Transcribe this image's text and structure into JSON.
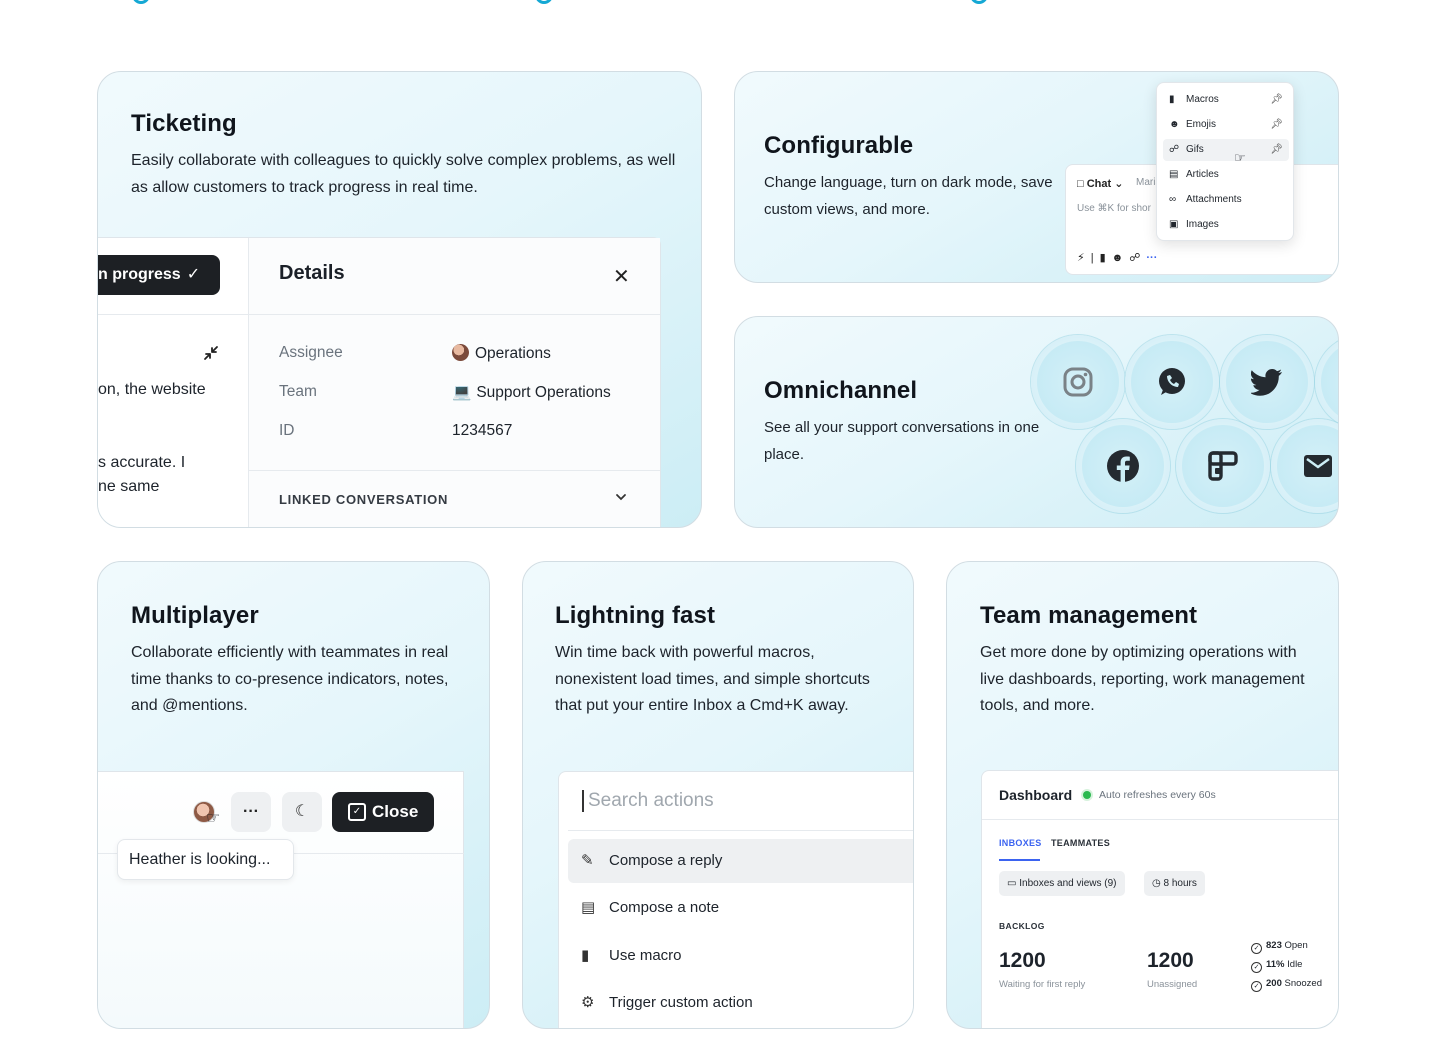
{
  "ticketing": {
    "title": "Ticketing",
    "description": "Easily collaborate with colleagues to quickly solve complex problems, as well as allow customers to track progress in real time.",
    "status_button": "n progress",
    "text_lines": [
      "on, the website",
      "s accurate. I",
      "ne same"
    ],
    "details": {
      "title": "Details",
      "rows": [
        {
          "label": "Assignee",
          "value": "Operations"
        },
        {
          "label": "Team",
          "value": "Support Operations"
        },
        {
          "label": "ID",
          "value": "1234567"
        }
      ],
      "linked_label": "LINKED CONVERSATION"
    }
  },
  "configurable": {
    "title": "Configurable",
    "description": "Change language, turn on dark mode, save custom views, and more.",
    "composer": {
      "channel": "Chat",
      "assignee_snippet": "Maria",
      "hint": "Use ⌘K for shor"
    },
    "menu": [
      "Macros",
      "Emojis",
      "Gifs",
      "Articles",
      "Attachments",
      "Images"
    ]
  },
  "omnichannel": {
    "title": "Omnichannel",
    "description": "See all your support conversations in one place.",
    "channels": [
      "instagram-icon",
      "whatsapp-icon",
      "twitter-icon",
      "facebook-icon",
      "front-icon",
      "mail-icon"
    ]
  },
  "multiplayer": {
    "title": "Multiplayer",
    "description": "Collaborate efficiently with teammates in real time thanks to co-presence indicators, notes, and @mentions.",
    "close_label": "Close",
    "tooltip": "Heather is looking..."
  },
  "lightning": {
    "title": "Lightning fast",
    "description": "Win time back with powerful macros, nonexistent load times, and simple shortcuts that put your entire Inbox a Cmd+K away.",
    "search_placeholder": "Search actions",
    "actions": [
      "Compose a reply",
      "Compose a note",
      "Use macro",
      "Trigger custom action"
    ]
  },
  "team": {
    "title": "Team management",
    "description": "Get more done by optimizing operations with live dashboards, reporting, work management tools, and more.",
    "dashboard": {
      "title": "Dashboard",
      "refresh": "Auto refreshes every 60s",
      "tabs": [
        "INBOXES",
        "TEAMMATES"
      ],
      "chips": [
        "Inboxes and views (9)",
        "8 hours"
      ],
      "section": "BACKLOG",
      "metrics": [
        {
          "value": "1200",
          "label": "Waiting for first reply"
        },
        {
          "value": "1200",
          "label": "Unassigned"
        }
      ],
      "stats": [
        {
          "value": "823",
          "label": "Open"
        },
        {
          "value": "11%",
          "label": "Idle"
        },
        {
          "value": "200",
          "label": "Snoozed"
        }
      ]
    }
  },
  "colors": {
    "accent": "#15a8d4",
    "dark_button": "#1d2024",
    "link_blue": "#3b63f0",
    "online_green": "#2bb94f"
  }
}
